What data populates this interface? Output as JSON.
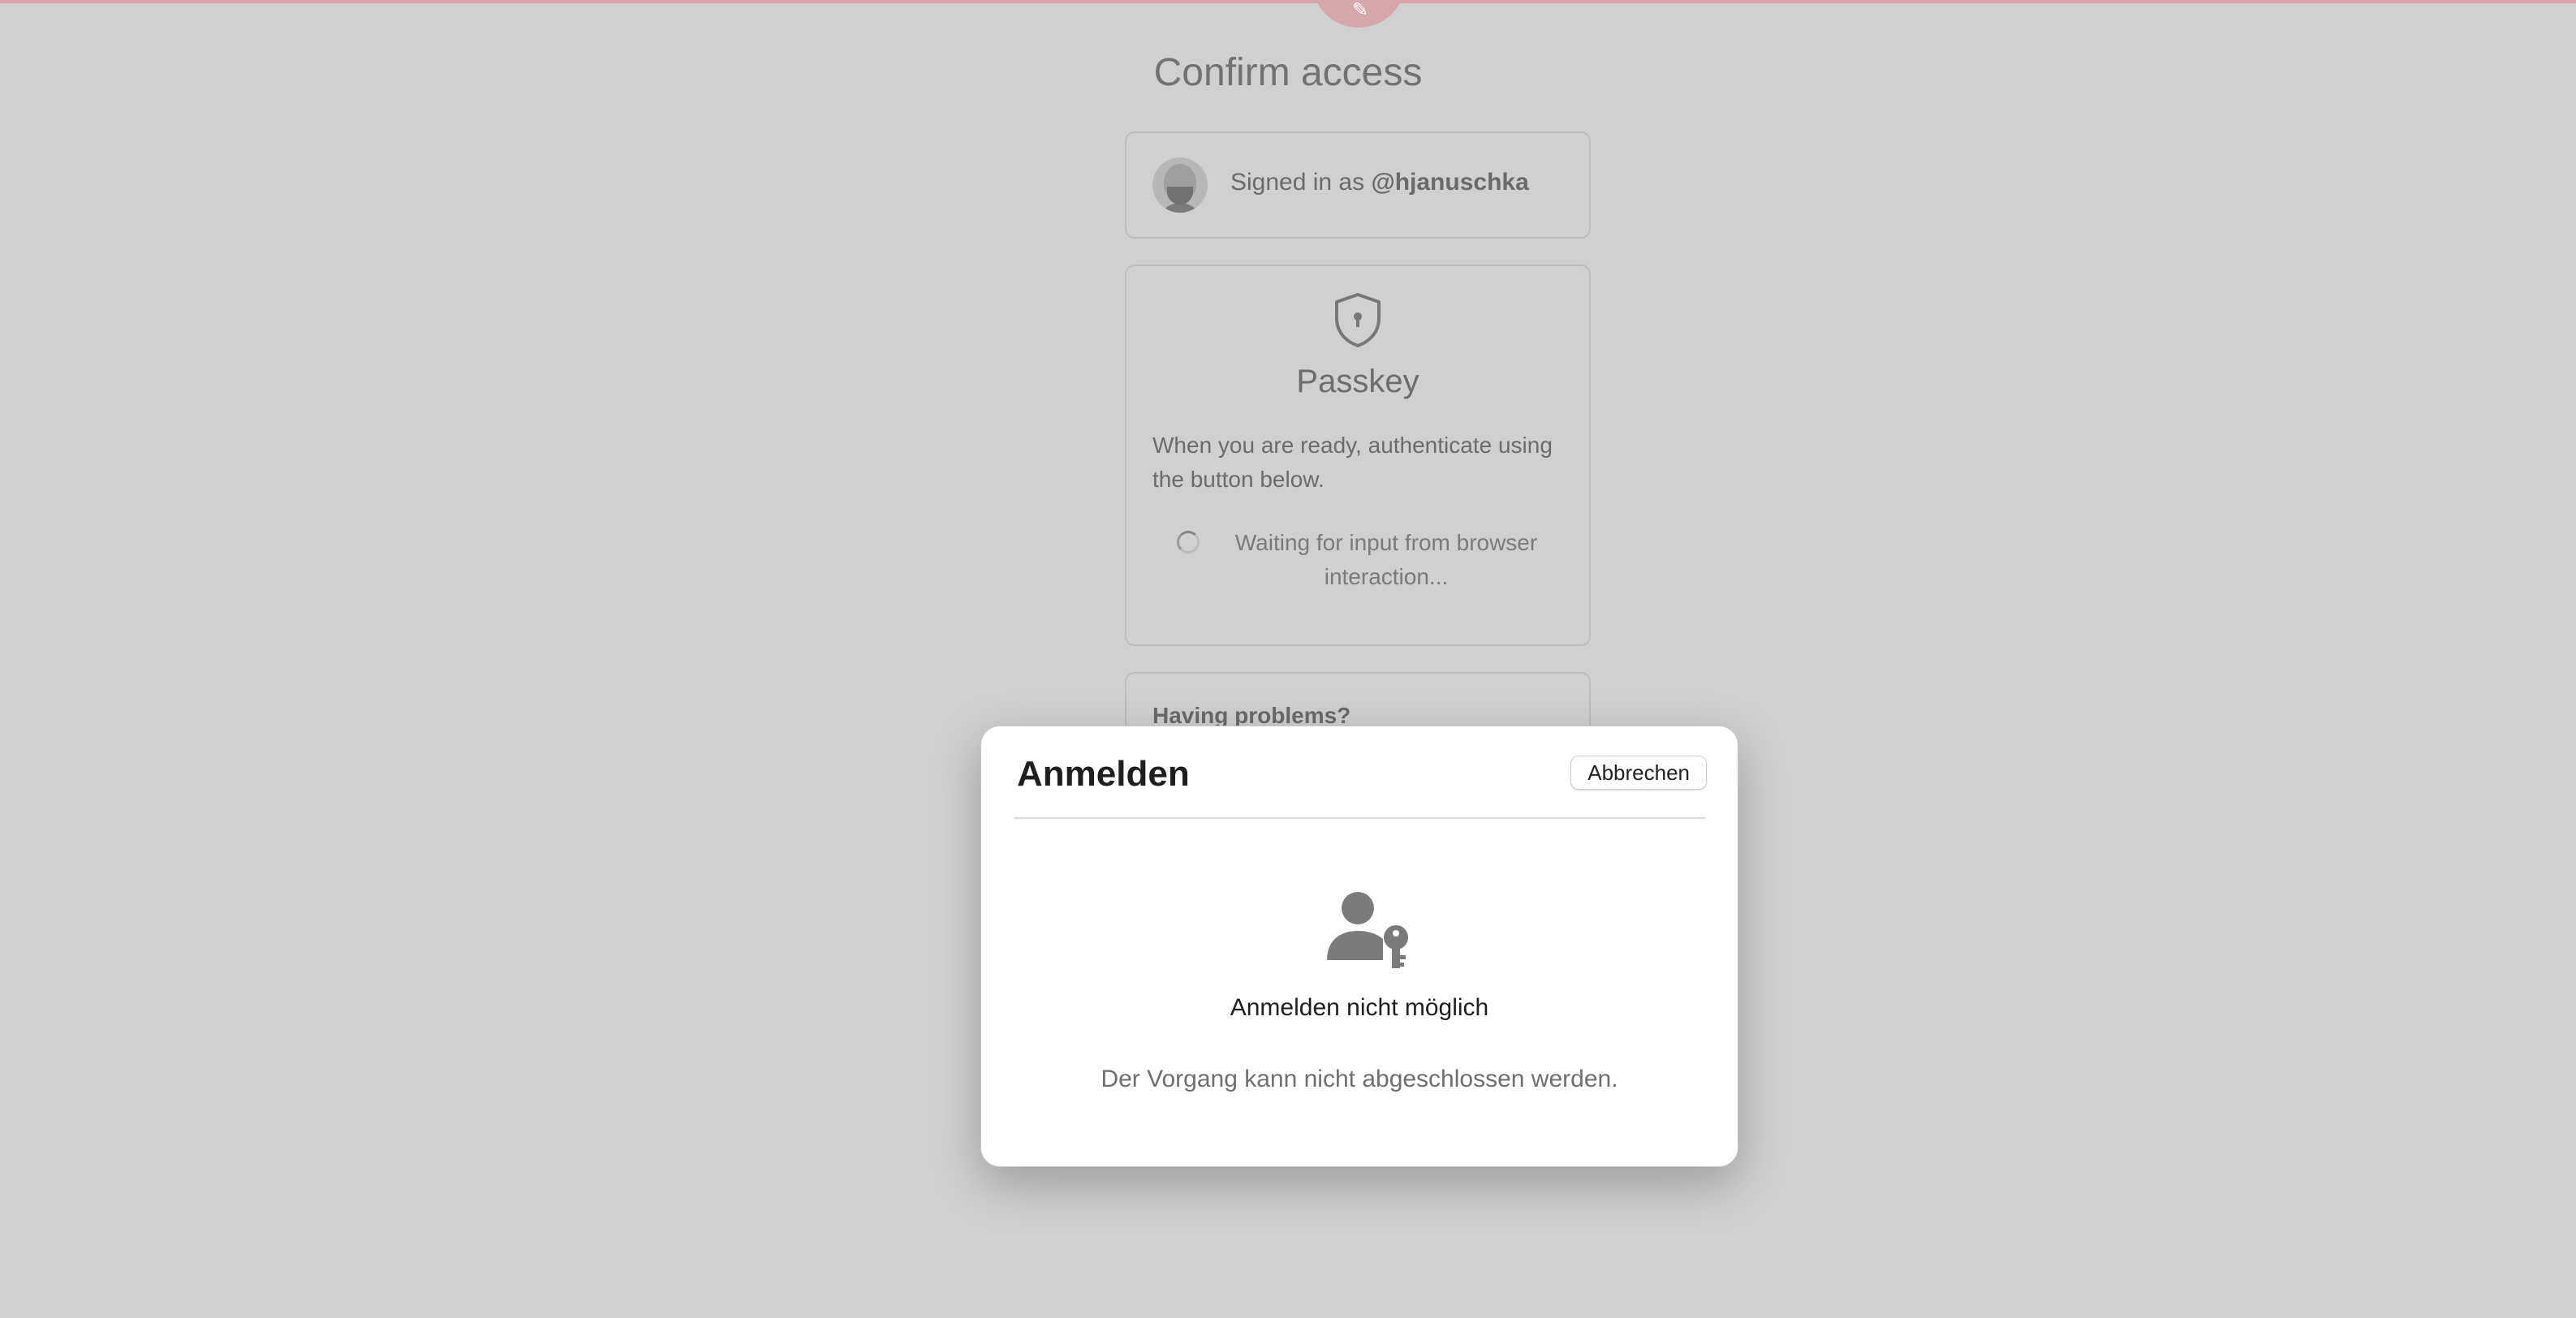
{
  "page": {
    "title": "Confirm access"
  },
  "account": {
    "signed_in_prefix": "Signed in as ",
    "username": "@hjanuschka"
  },
  "passkey": {
    "title": "Passkey",
    "description": "When you are ready, authenticate using the button below.",
    "status": "Waiting for input from browser interaction..."
  },
  "problems": {
    "title": "Having problems?"
  },
  "dialog": {
    "title": "Anmelden",
    "cancel_label": "Abbrechen",
    "message": "Anmelden nicht möglich",
    "detail": "Der Vorgang kann nicht abgeschlossen werden."
  },
  "icons": {
    "header": "feather-icon",
    "passkey": "shield-keyhole-icon",
    "loading": "spinner-icon",
    "dialog": "person-key-icon"
  },
  "colors": {
    "overlay_bg": "#d0d0d0",
    "header_accent": "#d7a6ab",
    "dialog_bg": "#ffffff"
  }
}
